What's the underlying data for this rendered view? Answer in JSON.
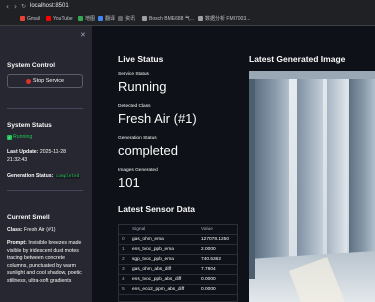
{
  "browser": {
    "url": "localhost:8501",
    "bookmarks": [
      "Gmail",
      "YouTube",
      "地图",
      "翻译",
      "资讯",
      "Bosch BME688 气...",
      "数据分析 FMI7003..."
    ]
  },
  "sidebar": {
    "system_control_heading": "System Control",
    "stop_button_label": "Stop Service",
    "system_status_heading": "System Status",
    "status_text": "Running",
    "last_update_label": "Last Update:",
    "last_update_value": "2025-11-28 21:32:43",
    "generation_status_label": "Generation Status:",
    "generation_status_value": "completed",
    "current_smell_heading": "Current Smell",
    "class_label": "Class:",
    "class_value": "Fresh Air (#1)",
    "prompt_label": "Prompt:",
    "prompt_text": "Invisible breezes made visible by iridescent dust motes tracing between concrete columns, punctuated by warm sunlight and cool shadow, poetic stillness, ultra-soft gradients"
  },
  "live_status": {
    "heading": "Live Status",
    "service_status_label": "Service Status",
    "service_status_value": "Running",
    "detected_class_label": "Detected Class",
    "detected_class_value": "Fresh Air (#1)",
    "generation_status_label": "Generation Status",
    "generation_status_value": "completed",
    "images_generated_label": "Images Generated",
    "images_generated_value": "101"
  },
  "sensor_table": {
    "heading": "Latest Sensor Data",
    "columns": [
      "",
      "Signal",
      "Value"
    ],
    "rows": [
      [
        "0",
        "gas_ohm_ema",
        "127078.1250"
      ],
      [
        "1",
        "ens_tvoc_ppb_ema",
        "2.0000"
      ],
      [
        "2",
        "sgp_tvoc_ppb_ema",
        "740.5362"
      ],
      [
        "3",
        "gas_ohm_abs_diff",
        "7.7804"
      ],
      [
        "4",
        "ens_tvoc_ppb_abs_diff",
        "0.0000"
      ],
      [
        "5",
        "ens_eco2_ppm_abs_diff",
        "0.0000"
      ]
    ]
  },
  "image_panel": {
    "heading": "Latest Generated Image"
  }
}
